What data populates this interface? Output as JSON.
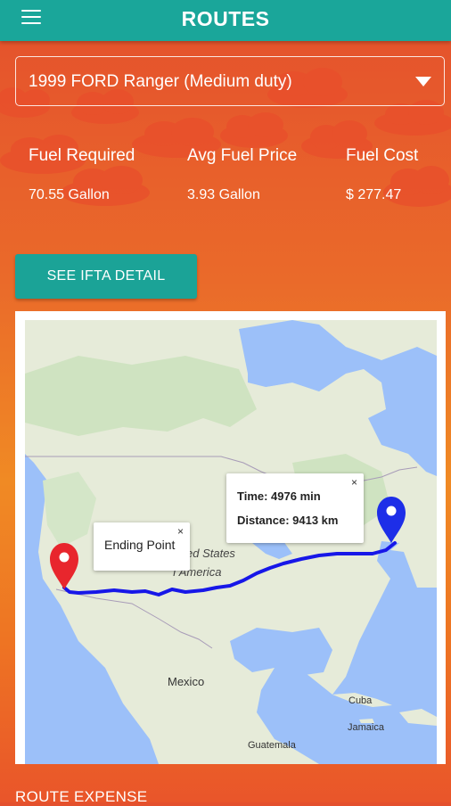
{
  "header": {
    "title": "ROUTES",
    "menu_icon": "hamburger-menu-icon"
  },
  "vehicle": {
    "selected": "1999 FORD Ranger (Medium duty)"
  },
  "stats": [
    {
      "label": "Fuel Required",
      "value": "70.55 Gallon"
    },
    {
      "label": "Avg Fuel Price",
      "value": "3.93 Gallon"
    },
    {
      "label": "Fuel Cost",
      "value": "$ 277.47"
    }
  ],
  "ifta_button": {
    "label": "SEE IFTA DETAIL"
  },
  "map": {
    "labels": {
      "states": "ed States",
      "america": "f America",
      "mexico": "Mexico",
      "cuba": "Cuba",
      "jamaica": "Jamaica",
      "guatemala": "Guatemala"
    },
    "end_popup": {
      "text": "Ending Point",
      "close": "×"
    },
    "start_popup": {
      "time": "Time: 4976 min",
      "distance": "Distance: 9413 km",
      "close": "×"
    },
    "route_color": "#1717e8",
    "end_marker_color": "#e8262d",
    "start_marker_color": "#1d2ee8"
  },
  "section": {
    "route_expense": "ROUTE EXPENSE"
  }
}
